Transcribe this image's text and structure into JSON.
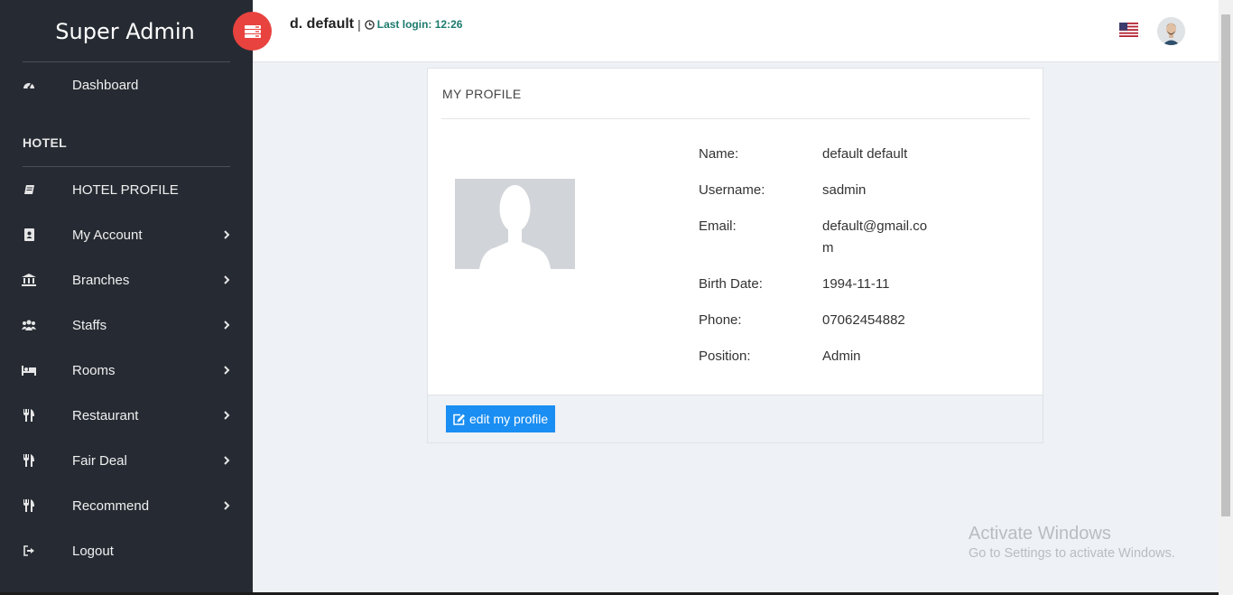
{
  "brand": "Super Admin",
  "topbar": {
    "user_name": "d. default",
    "separator": "|",
    "last_login": "Last login: 12:26"
  },
  "nav": {
    "dashboard": "Dashboard",
    "section_hotel": "HOTEL",
    "items": [
      {
        "label": "HOTEL PROFILE",
        "icon": "book-icon"
      },
      {
        "label": "My Account",
        "icon": "contact-book-icon"
      },
      {
        "label": "Branches",
        "icon": "bank-icon"
      },
      {
        "label": "Staffs",
        "icon": "users-icon"
      },
      {
        "label": "Rooms",
        "icon": "bed-icon"
      },
      {
        "label": "Restaurant",
        "icon": "cutlery-icon"
      },
      {
        "label": "Fair Deal",
        "icon": "cutlery-icon"
      },
      {
        "label": "Recommend",
        "icon": "cutlery-icon"
      },
      {
        "label": "Logout",
        "icon": "sign-out-icon"
      }
    ]
  },
  "profile": {
    "title": "MY PROFILE",
    "fields": [
      {
        "label": "Name:",
        "value": "default default"
      },
      {
        "label": "Username:",
        "value": "sadmin"
      },
      {
        "label": "Email:",
        "value": "default@gmail.com"
      },
      {
        "label": "Birth Date:",
        "value": "1994-11-11"
      },
      {
        "label": "Phone:",
        "value": "07062454882"
      },
      {
        "label": "Position:",
        "value": "Admin"
      }
    ],
    "edit_button": "edit my profile"
  },
  "watermark": {
    "line1": "Activate Windows",
    "line2": "Go to Settings to activate Windows."
  },
  "colors": {
    "sidebar": "#262b33",
    "toggle": "#e8433f",
    "button": "#1a8ef2",
    "last_login": "#1c7a6e"
  }
}
